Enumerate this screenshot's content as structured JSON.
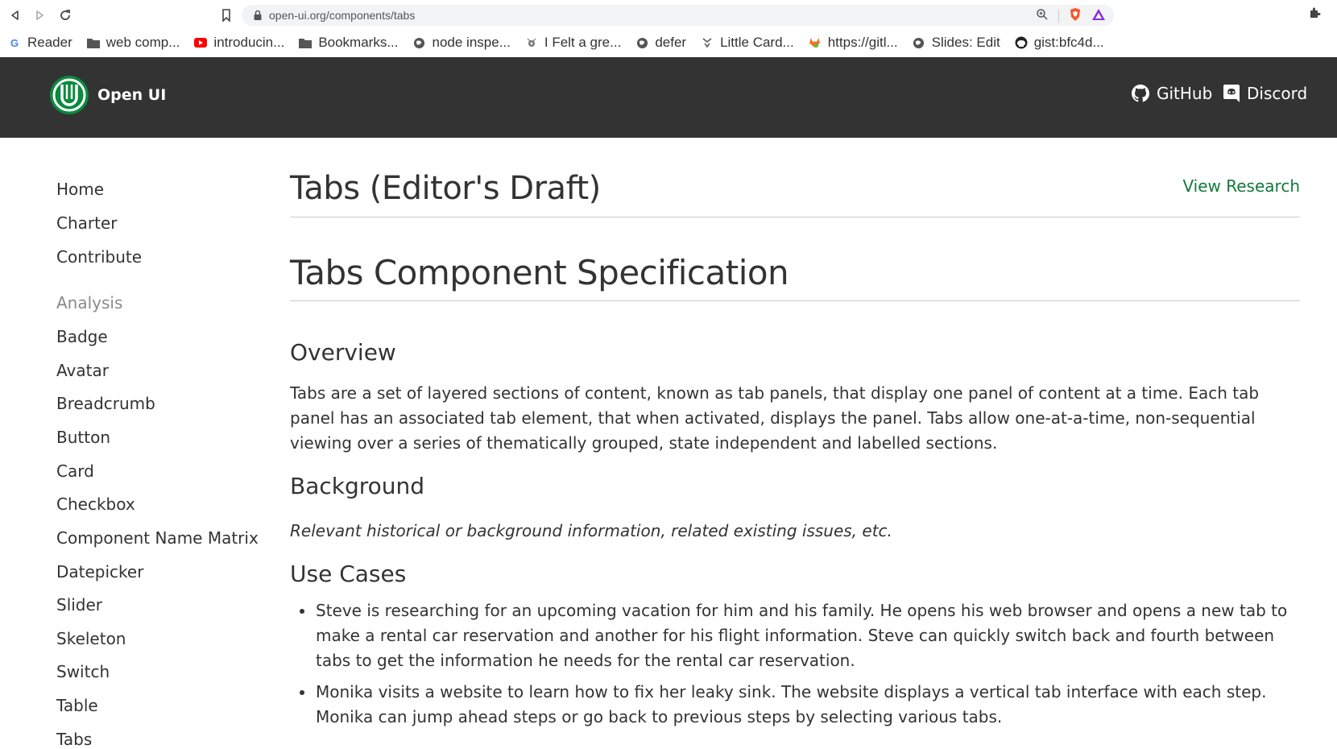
{
  "browser": {
    "url": "open-ui.org/components/tabs",
    "bookmarks": [
      {
        "label": "Reader",
        "icon": "google-icon"
      },
      {
        "label": "web comp...",
        "icon": "folder-icon"
      },
      {
        "label": "introducin...",
        "icon": "youtube-icon"
      },
      {
        "label": "Bookmarks...",
        "icon": "folder-icon"
      },
      {
        "label": "node inspe...",
        "icon": "globe-icon"
      },
      {
        "label": "I Felt a gre...",
        "icon": "site-icon"
      },
      {
        "label": "defer",
        "icon": "globe-icon"
      },
      {
        "label": "Little Card...",
        "icon": "site-icon"
      },
      {
        "label": "https://gitl...",
        "icon": "gitlab-icon"
      },
      {
        "label": "Slides: Edit",
        "icon": "globe-icon"
      },
      {
        "label": "gist:bfc4d...",
        "icon": "github-icon"
      }
    ]
  },
  "header": {
    "site_title": "Open UI",
    "github_label": "GitHub",
    "discord_label": "Discord",
    "brand_color": "#0a8a3c"
  },
  "sidebar": {
    "items": [
      {
        "label": "Home"
      },
      {
        "label": "Charter"
      },
      {
        "label": "Contribute"
      },
      {
        "label": "Analysis",
        "section": true
      },
      {
        "label": "Badge"
      },
      {
        "label": "Avatar"
      },
      {
        "label": "Breadcrumb"
      },
      {
        "label": "Button"
      },
      {
        "label": "Card"
      },
      {
        "label": "Checkbox"
      },
      {
        "label": "Component Name Matrix"
      },
      {
        "label": "Datepicker"
      },
      {
        "label": "Slider"
      },
      {
        "label": "Skeleton"
      },
      {
        "label": "Switch"
      },
      {
        "label": "Table"
      },
      {
        "label": "Tabs"
      }
    ]
  },
  "main": {
    "page_title": "Tabs (Editor's Draft)",
    "view_research_label": "View Research",
    "spec_title": "Tabs Component Specification",
    "overview_heading": "Overview",
    "overview_text": "Tabs are a set of layered sections of content, known as tab panels, that display one panel of content at a time. Each tab panel has an associated tab element, that when activated, displays the panel. Tabs allow one-at-a-time, non-sequential viewing over a series of thematically grouped, state independent and labelled sections.",
    "background_heading": "Background",
    "background_text": "Relevant historical or background information, related existing issues, etc.",
    "use_cases_heading": "Use Cases",
    "use_cases": [
      "Steve is researching for an upcoming vacation for him and his family. He opens his web browser and opens a new tab to make a rental car reservation and another for his flight information. Steve can quickly switch back and fourth between tabs to get the information he needs for the rental car reservation.",
      "Monika visits a website to learn how to fix her leaky sink. The website displays a vertical tab interface with each step. Monika can jump ahead steps or go back to previous steps by selecting various tabs."
    ]
  }
}
